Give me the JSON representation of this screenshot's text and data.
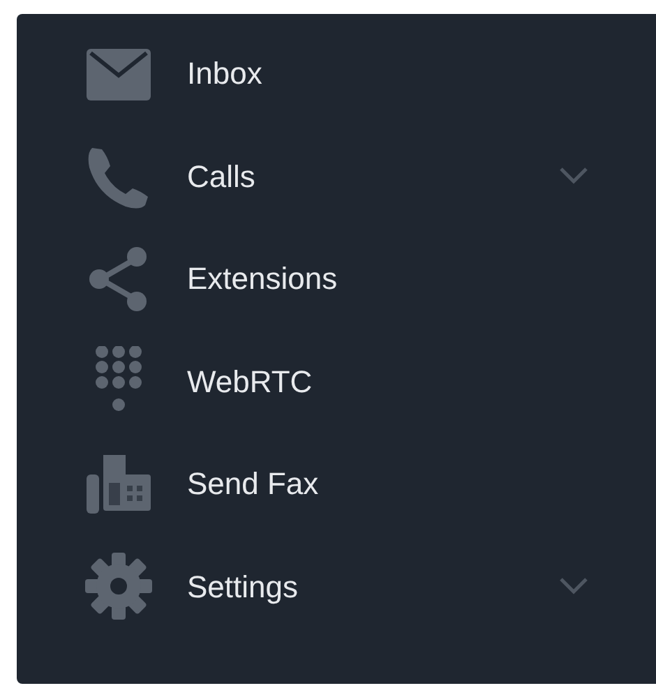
{
  "sidebar": {
    "items": [
      {
        "kind": "inbox",
        "label": "Inbox",
        "expandable": false
      },
      {
        "kind": "calls",
        "label": "Calls",
        "expandable": true
      },
      {
        "kind": "extensions",
        "label": "Extensions",
        "expandable": false
      },
      {
        "kind": "webrtc",
        "label": "WebRTC",
        "expandable": false
      },
      {
        "kind": "fax",
        "label": "Send Fax",
        "expandable": false
      },
      {
        "kind": "settings",
        "label": "Settings",
        "expandable": true
      }
    ]
  }
}
